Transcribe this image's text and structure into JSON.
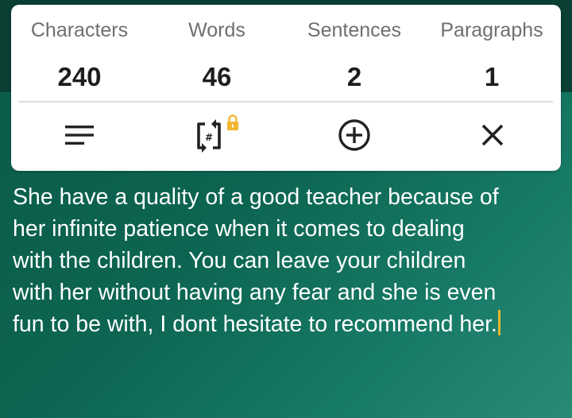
{
  "stats": [
    {
      "label": "Characters",
      "value": "240"
    },
    {
      "label": "Words",
      "value": "46"
    },
    {
      "label": "Sentences",
      "value": "2"
    },
    {
      "label": "Paragraphs",
      "value": "1"
    }
  ],
  "toolbar": {
    "icons": [
      "text-align-icon",
      "word-replace-locked-icon",
      "add-circle-icon",
      "close-icon"
    ],
    "lock_color": "#f2b630"
  },
  "editor": {
    "text": "She have a quality of a good teacher because of\nher infinite patience when it comes to dealing\nwith the children. You can leave your children\nwith her without having any fear and she is even\nfun to be with, I dont hesitate to recommend her."
  },
  "colors": {
    "card_background": "#ffffff",
    "caret": "#f2b630",
    "background_dark": "#0a3f33",
    "background_teal": "#0c6552"
  }
}
